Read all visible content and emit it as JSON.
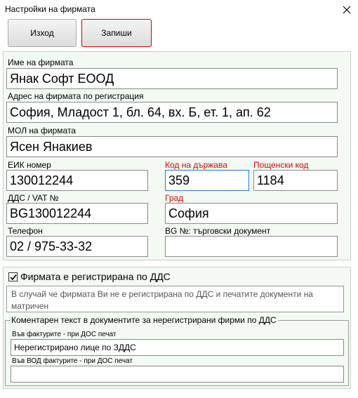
{
  "window": {
    "title": "Настройки на фирмата"
  },
  "toolbar": {
    "exit_label": "Изход",
    "save_label": "Запиши"
  },
  "form": {
    "company_name": {
      "label": "Име на фирмата",
      "value": "Янак Софт ЕООД"
    },
    "address": {
      "label": "Адрес на фирмата по регистрация",
      "value": "София, Младост 1, бл. 64, вх. Б, ет. 1, ап. 62"
    },
    "mol": {
      "label": "МОЛ на фирмата",
      "value": "Ясен Янакиев"
    },
    "eik": {
      "label": "ЕИК номер",
      "value": "130012244"
    },
    "country_code": {
      "label": "Код на държава",
      "value": "359"
    },
    "postal_code": {
      "label": "Пощенски код",
      "value": "1184"
    },
    "vat": {
      "label": "ДДС / VAT №",
      "value": "BG130012244"
    },
    "city": {
      "label": "Град",
      "value": "София"
    },
    "phone": {
      "label": "Телефон",
      "value": "02 / 975-33-32"
    },
    "bg_trade_doc": {
      "label": "BG №: търговски документ",
      "value": ""
    }
  },
  "vat_registered": {
    "label": "Фирмата е регистрирана по ДДС",
    "checked": true
  },
  "note": {
    "text": "В случай че фирмата Ви не е регистрирана по ДДС и печатите документи на матричен"
  },
  "comment_group": {
    "title": "Коментарен текст в документите за нерегистрирани фирми по ДДС",
    "invoices_label": "Във фактурите - при ДОС печат",
    "invoices_value": "Нерегистрирано лице по ЗДДС",
    "vod_invoices_label": "Във ВОД фактурите - при ДОС печат",
    "vod_invoices_value": ""
  },
  "colors": {
    "panel_bg": "#f3f9f3",
    "required_label": "#e00000",
    "focus_border": "#2a79c9"
  },
  "icons": {
    "close": "close-icon",
    "check": "check-icon"
  }
}
